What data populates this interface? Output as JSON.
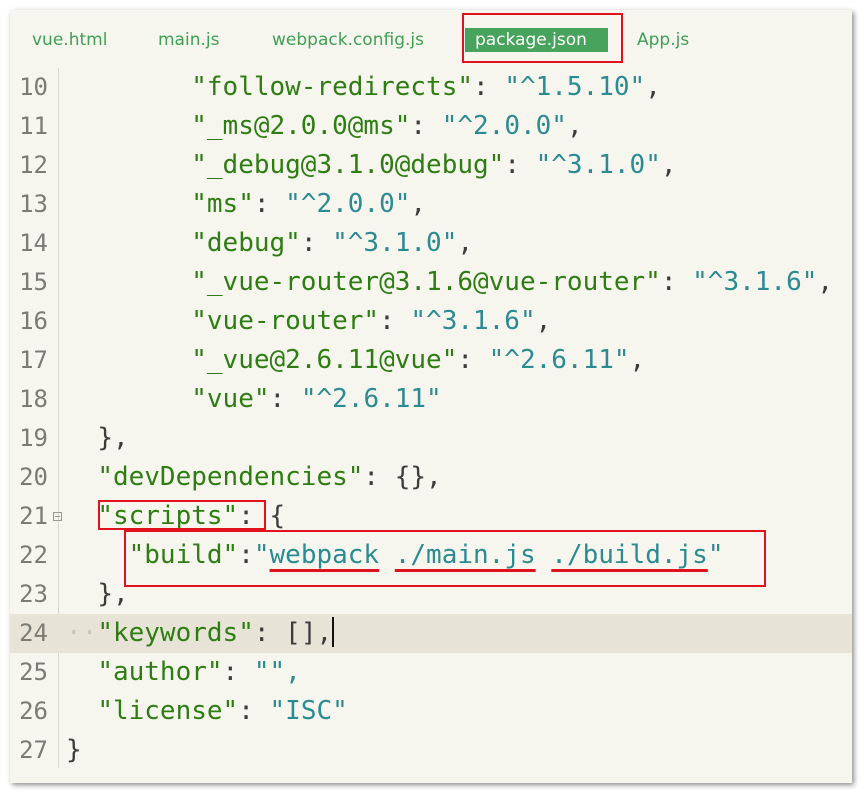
{
  "tabs": [
    {
      "label": "vue.html",
      "active": false
    },
    {
      "label": "main.js",
      "active": false
    },
    {
      "label": "webpack.config.js",
      "active": false
    },
    {
      "label": "package.json",
      "active": true
    },
    {
      "label": "App.js",
      "active": false
    }
  ],
  "editor": {
    "lines": {
      "l10": {
        "num": "10",
        "key": "\"follow-redirects\"",
        "val": "\"^1.5.10\""
      },
      "l11": {
        "num": "11",
        "key": "\"_ms@2.0.0@ms\"",
        "val": "\"^2.0.0\""
      },
      "l12": {
        "num": "12",
        "key": "\"_debug@3.1.0@debug\"",
        "val": "\"^3.1.0\""
      },
      "l13": {
        "num": "13",
        "key": "\"ms\"",
        "val": "\"^2.0.0\""
      },
      "l14": {
        "num": "14",
        "key": "\"debug\"",
        "val": "\"^3.1.0\""
      },
      "l15": {
        "num": "15",
        "key": "\"_vue-router@3.1.6@vue-router\"",
        "val": "\"^3.1.6\""
      },
      "l16": {
        "num": "16",
        "key": "\"vue-router\"",
        "val": "\"^3.1.6\""
      },
      "l17": {
        "num": "17",
        "key": "\"_vue@2.6.11@vue\"",
        "val": "\"^2.6.11\""
      },
      "l18": {
        "num": "18",
        "key": "\"vue\"",
        "val": "\"^2.6.11\""
      },
      "l19": {
        "num": "19",
        "text": "},"
      },
      "l20": {
        "num": "20",
        "key": "\"devDependencies\"",
        "val": "{},"
      },
      "l21": {
        "num": "21",
        "key": "\"scripts\"",
        "val": "{"
      },
      "l22": {
        "num": "22",
        "key": "\"build\"",
        "val_q1": "\"",
        "val_a": "webpack",
        "val_b": "./main.js",
        "val_c": "./build.js",
        "val_q2": "\""
      },
      "l23": {
        "num": "23",
        "text": "},"
      },
      "l24": {
        "num": "24",
        "key": "\"keywords\"",
        "val": "[],"
      },
      "l25": {
        "num": "25",
        "key": "\"author\"",
        "val": "\"\","
      },
      "l26": {
        "num": "26",
        "key": "\"license\"",
        "val": "\"ISC\""
      },
      "l27": {
        "num": "27",
        "text": "}"
      }
    }
  },
  "colors": {
    "key": "#2e7d12",
    "string": "#2b8a92",
    "annotation": "#e0121b",
    "active_tab": "#48a35c"
  }
}
